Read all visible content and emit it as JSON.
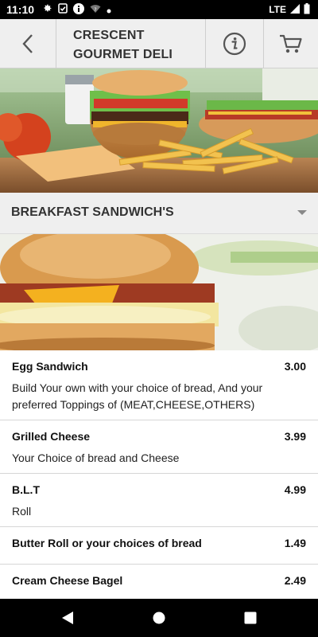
{
  "status_bar": {
    "time": "11:10",
    "network": "LTE",
    "icons_left": [
      "gear-icon",
      "clipboard-check-icon",
      "info-icon",
      "wifi-question-icon",
      "dot-icon"
    ],
    "icons_right": [
      "signal-icon",
      "battery-icon"
    ]
  },
  "header": {
    "title_line1": "CRESCENT",
    "title_line2": "GOURMET DELI",
    "back_icon": "chevron-left-icon",
    "info_icon": "info-circle-icon",
    "cart_icon": "cart-icon"
  },
  "category": {
    "label": "BREAKFAST SANDWICH'S",
    "icon": "dropdown-caret-icon"
  },
  "menu": {
    "items": [
      {
        "name": "Egg Sandwich",
        "price": "3.00",
        "desc": "Build Your own with your choice of bread, And your preferred Toppings of (MEAT,CHEESE,OTHERS)"
      },
      {
        "name": "Grilled Cheese",
        "price": "3.99",
        "desc": "Your Choice of bread and Cheese"
      },
      {
        "name": "B.L.T",
        "price": "4.99",
        "desc": "Roll"
      },
      {
        "name": "Butter Roll or your choices of bread",
        "price": "1.49",
        "desc": ""
      },
      {
        "name": "Cream Cheese Bagel",
        "price": "2.49",
        "desc": ""
      }
    ]
  },
  "nav_bar": {
    "back": "nav-back-icon",
    "home": "nav-home-icon",
    "recents": "nav-recents-icon"
  },
  "colors": {
    "header_bg": "#efefef",
    "status_bg": "#000000",
    "text": "#111111"
  }
}
